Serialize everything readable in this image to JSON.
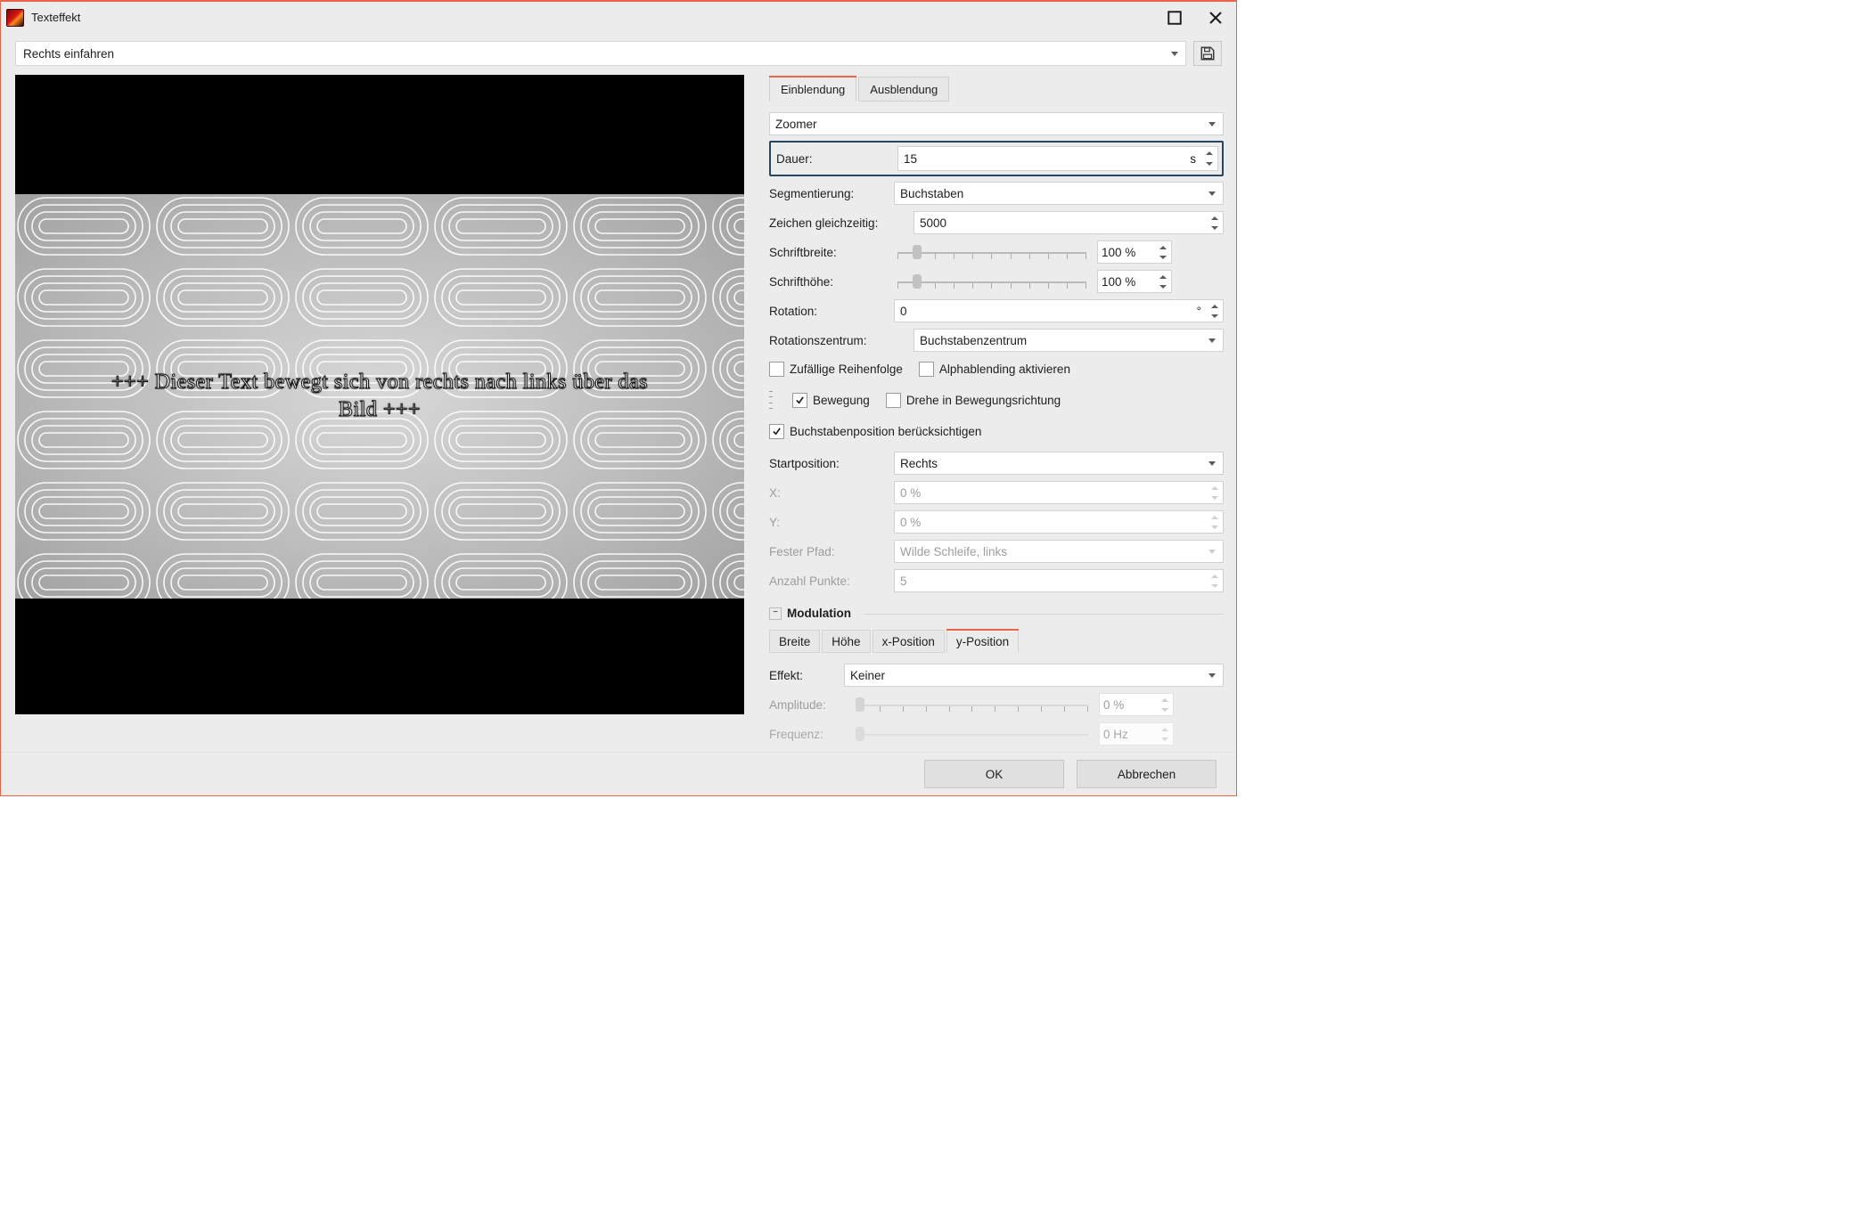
{
  "window": {
    "title": "Texteffekt"
  },
  "preset": {
    "value": "Rechts einfahren"
  },
  "preview": {
    "text": "+++ Dieser Text bewegt sich von rechts nach links über das Bild +++"
  },
  "tabs": {
    "einblendung": "Einblendung",
    "ausblendung": "Ausblendung",
    "active": "einblendung"
  },
  "zoomer": {
    "label": "Zoomer"
  },
  "dauer": {
    "label": "Dauer:",
    "value": "15",
    "unit": "s"
  },
  "segmentierung": {
    "label": "Segmentierung:",
    "value": "Buchstaben"
  },
  "zeichen": {
    "label": "Zeichen gleichzeitig:",
    "value": "5000"
  },
  "schriftbreite": {
    "label": "Schriftbreite:",
    "value": "100 %"
  },
  "schrifthoehe": {
    "label": "Schrifthöhe:",
    "value": "100 %"
  },
  "rotation": {
    "label": "Rotation:",
    "value": "0",
    "unit": "°"
  },
  "rotzentrum": {
    "label": "Rotationszentrum:",
    "value": "Buchstabenzentrum"
  },
  "checks": {
    "zufaellig": "Zufällige Reihenfolge",
    "alpha": "Alphablending aktivieren",
    "bewegung": "Bewegung",
    "drehe": "Drehe in Bewegungsrichtung",
    "buchstaben": "Buchstabenposition berücksichtigen"
  },
  "startpos": {
    "label": "Startposition:",
    "value": "Rechts"
  },
  "x": {
    "label": "X:",
    "value": "0 %"
  },
  "y": {
    "label": "Y:",
    "value": "0 %"
  },
  "pfad": {
    "label": "Fester Pfad:",
    "value": "Wilde Schleife, links"
  },
  "punkte": {
    "label": "Anzahl Punkte:",
    "value": "5"
  },
  "modulation": {
    "title": "Modulation"
  },
  "subtabs": {
    "breite": "Breite",
    "hoehe": "Höhe",
    "xpos": "x-Position",
    "ypos": "y-Position",
    "active": "ypos"
  },
  "effekt": {
    "label": "Effekt:",
    "value": "Keiner"
  },
  "amplitude": {
    "label": "Amplitude:",
    "value": "0 %"
  },
  "frequenz": {
    "label": "Frequenz:",
    "value": "0 Hz"
  },
  "footer": {
    "ok": "OK",
    "cancel": "Abbrechen"
  }
}
